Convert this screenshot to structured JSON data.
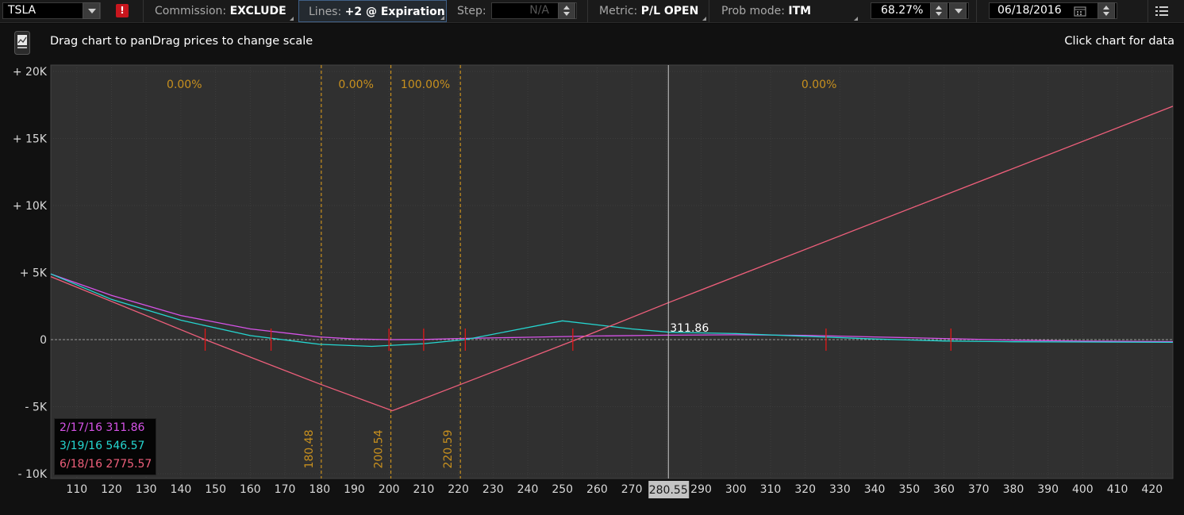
{
  "toolbar": {
    "symbol": "TSLA",
    "alert_badge": "!",
    "commission_label": "Commission:",
    "commission_value": "EXCLUDE",
    "lines_label": "Lines:",
    "lines_value": "+2 @ Expiration",
    "step_label": "Step:",
    "step_value": "N/A",
    "metric_label": "Metric:",
    "metric_value": "P/L OPEN",
    "prob_label": "Prob mode:",
    "prob_value": "ITM",
    "probability": "68.27%",
    "date": "06/18/2016",
    "icons": [
      "dropdown-arrow-icon",
      "alert-icon",
      "spinner-icon",
      "calendar-icon",
      "menu-icon"
    ]
  },
  "chart_header": {
    "left_hint": "Drag chart to panDrag prices to change scale",
    "right_hint": "Click chart for data",
    "icon": "chart-thumbnail-icon"
  },
  "colors": {
    "background": "#111111",
    "plot": "#303030",
    "series_1": "#d653e8",
    "series_2": "#25d6d0",
    "series_3": "#ef5f7b",
    "prob_lines": "#c8901e",
    "markers": "#e01818"
  },
  "chart_data": {
    "type": "line",
    "x_ticks": [
      110,
      120,
      130,
      140,
      150,
      160,
      170,
      180,
      190,
      200,
      210,
      220,
      230,
      240,
      250,
      260,
      270,
      280,
      290,
      300,
      310,
      320,
      330,
      340,
      350,
      360,
      370,
      380,
      390,
      400,
      410,
      420
    ],
    "xlim": [
      102.5,
      426
    ],
    "y_ticks": [
      {
        "value": 20000,
        "label": "+ 20K"
      },
      {
        "value": 15000,
        "label": "+ 15K"
      },
      {
        "value": 10000,
        "label": "+ 10K"
      },
      {
        "value": 5000,
        "label": "+ 5K"
      },
      {
        "value": 0,
        "label": "0"
      },
      {
        "value": -5000,
        "label": "- 5K"
      },
      {
        "value": -10000,
        "label": "- 10K"
      }
    ],
    "ylim": [
      -10000,
      20000
    ],
    "grid": true,
    "current_price": 280.55,
    "crosshair_label": "311.86",
    "prob_lines": [
      {
        "x": 180.48,
        "label": "180.48"
      },
      {
        "x": 200.54,
        "label": "200.54"
      },
      {
        "x": 220.59,
        "label": "220.59"
      }
    ],
    "prob_zones": [
      {
        "x": 141,
        "label": "0.00%"
      },
      {
        "x": 190.5,
        "label": "0.00%"
      },
      {
        "x": 210.5,
        "label": "100.00%"
      },
      {
        "x": 324,
        "label": "0.00%"
      }
    ],
    "legend_placement": "bottom-left",
    "series": [
      {
        "name": "2/17/16 311.86",
        "color": "#d653e8",
        "points": [
          [
            102.5,
            4900
          ],
          [
            120,
            3300
          ],
          [
            140,
            1800
          ],
          [
            160,
            800
          ],
          [
            180,
            200
          ],
          [
            190,
            50
          ],
          [
            200,
            0
          ],
          [
            210,
            10
          ],
          [
            220,
            80
          ],
          [
            240,
            180
          ],
          [
            260,
            270
          ],
          [
            280,
            330
          ],
          [
            300,
            360
          ],
          [
            320,
            320
          ],
          [
            340,
            200
          ],
          [
            360,
            80
          ],
          [
            380,
            -40
          ],
          [
            400,
            -110
          ],
          [
            426,
            -150
          ]
        ]
      },
      {
        "name": "3/19/16 546.57",
        "color": "#25d6d0",
        "points": [
          [
            102.5,
            4900
          ],
          [
            120,
            3000
          ],
          [
            140,
            1450
          ],
          [
            160,
            300
          ],
          [
            180,
            -350
          ],
          [
            195,
            -500
          ],
          [
            210,
            -300
          ],
          [
            222,
            0
          ],
          [
            235,
            650
          ],
          [
            250,
            1400
          ],
          [
            260,
            1100
          ],
          [
            270,
            800
          ],
          [
            281,
            550
          ],
          [
            300,
            450
          ],
          [
            320,
            250
          ],
          [
            340,
            50
          ],
          [
            360,
            -100
          ],
          [
            380,
            -160
          ],
          [
            400,
            -180
          ],
          [
            426,
            -200
          ]
        ]
      },
      {
        "name": "6/18/16 2775.57",
        "color": "#ef5f7b",
        "points": [
          [
            102.5,
            4700
          ],
          [
            147,
            0
          ],
          [
            180,
            -3300
          ],
          [
            201,
            -5300
          ],
          [
            221,
            -3300
          ],
          [
            254,
            0
          ],
          [
            281,
            2800
          ],
          [
            426,
            17400
          ]
        ]
      }
    ],
    "markers": [
      [
        147,
        0
      ],
      [
        166,
        0
      ],
      [
        200,
        0
      ],
      [
        210,
        0
      ],
      [
        222,
        0
      ],
      [
        253,
        0
      ],
      [
        326,
        0
      ],
      [
        362,
        0
      ]
    ]
  }
}
